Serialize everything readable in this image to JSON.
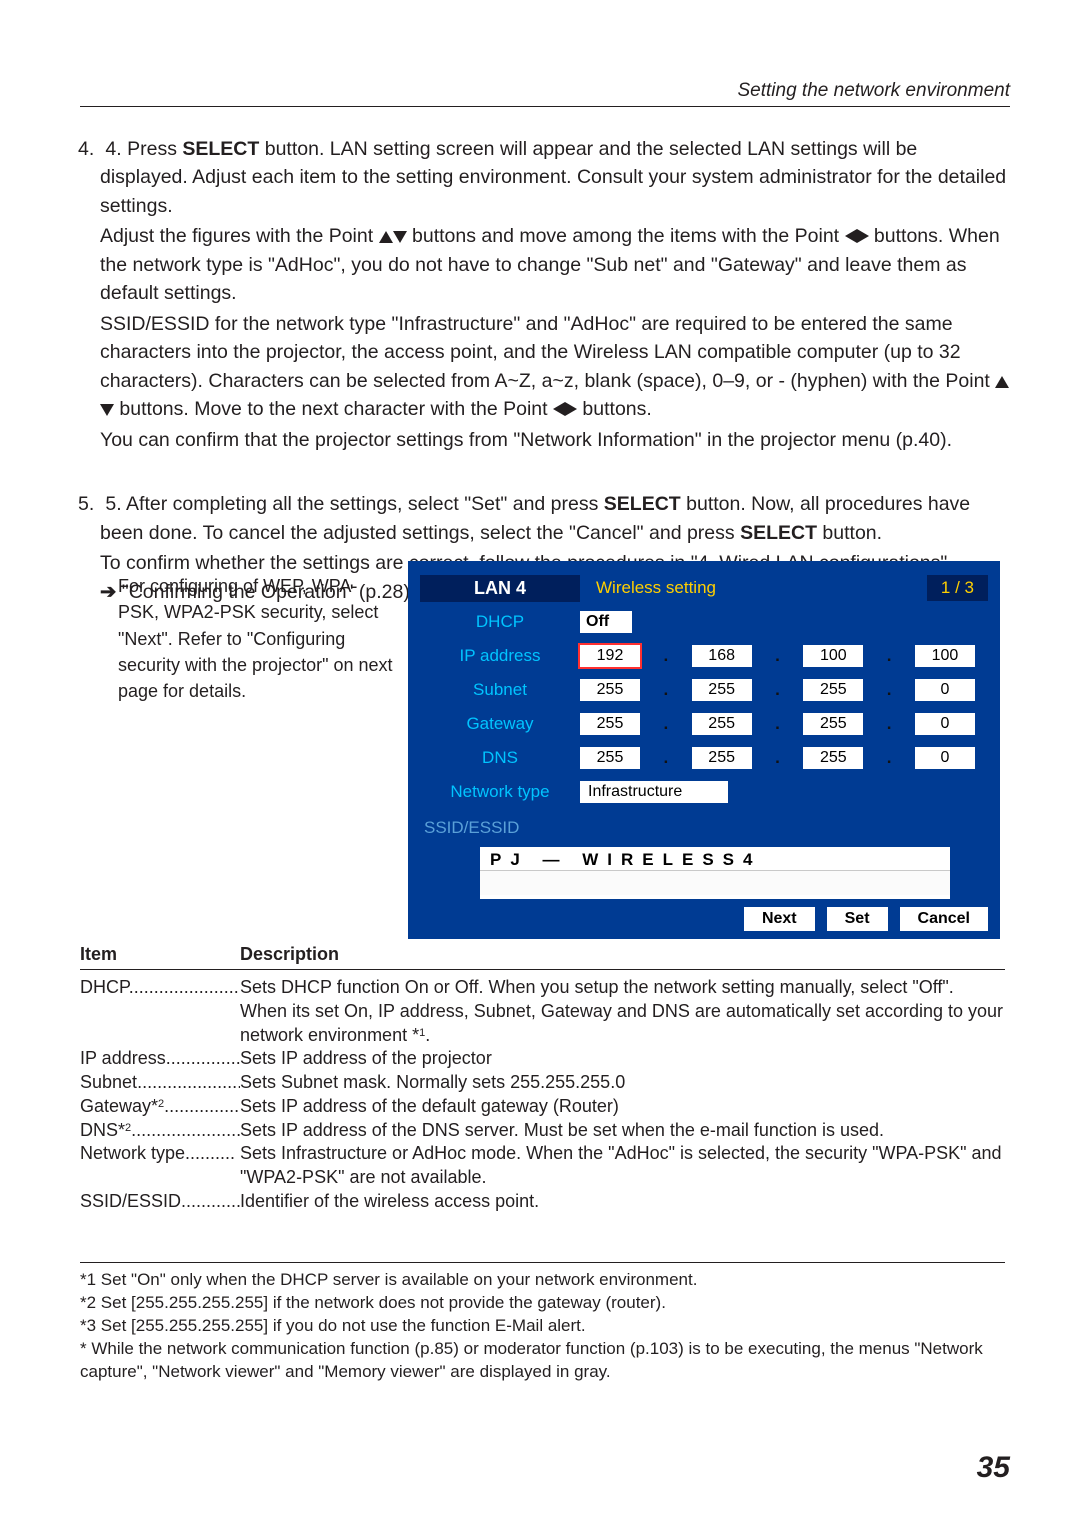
{
  "header": {
    "section_title": "Setting  the network environment"
  },
  "step4": {
    "line1_a": "4. Press ",
    "line1_b": "SELECT",
    "line1_c": " button. LAN setting screen will appear and the selected LAN settings will be displayed. Adjust each item to the setting environment. Consult your system administrator for the detailed settings.",
    "line2_a": "Adjust the figures with the Point ",
    "line2_b": " buttons and move among the items with the Point ",
    "line2_c": " buttons. When the network type is \"AdHoc\", you do not have to change \"Sub net\" and \"Gateway\" and leave them as default settings.",
    "line3": "SSID/ESSID for the network type \"Infrastructure\" and \"AdHoc\" are required to be entered the same characters into the projector, the access point, and the Wireless LAN compatible computer (up to 32 characters). Characters can be selected from A~Z, a~z, blank (space), 0–9, or - (hyphen) with the Point ",
    "line3_b": " buttons. Move to the next character with the Point ",
    "line3_c": " buttons.",
    "line4": "You can confirm that the projector settings from \"Network Information\" in the projector menu (p.40)."
  },
  "step5": {
    "line1_a": "5. After completing all the settings, select \"Set\" and press ",
    "line1_b": "SELECT",
    "line1_c": " button. Now, all procedures have been done. To cancel the adjusted settings, select the \"Cancel\" and press ",
    "line1_d": "SELECT",
    "line1_e": " button.",
    "line2": "To confirm whether the settings are correct, follow the procedures in \"4. Wired LAN configurations\" ",
    "line2_b": " \"Confirming the Operation\" (p.28)."
  },
  "sidenote": "For configuring of WEP, WPA-PSK, WPA2-PSK security, select \"Next\". Refer to  \"Configuring security with the projector\" on next page for details.",
  "panel": {
    "title": "LAN 4",
    "header": "Wireless setting",
    "page": "1 / 3",
    "labels": {
      "dhcp": "DHCP",
      "ip": "IP address",
      "subnet": "Subnet",
      "gateway": "Gateway",
      "dns": "DNS",
      "nettype": "Network type",
      "ssid": "SSID/ESSID"
    },
    "dhcp_value": "Off",
    "ip": [
      "192",
      "168",
      "100",
      "100"
    ],
    "subnet": [
      "255",
      "255",
      "255",
      "0"
    ],
    "gateway": [
      "255",
      "255",
      "255",
      "0"
    ],
    "dns": [
      "255",
      "255",
      "255",
      "0"
    ],
    "nettype_value": "Infrastructure",
    "ssid_value": "PJ — WIRELESS4",
    "btn_next": "Next",
    "btn_set": "Set",
    "btn_cancel": "Cancel"
  },
  "table": {
    "h_item": "Item",
    "h_desc": "Description",
    "rows": [
      {
        "item": "DHCP",
        "dots": "...........................",
        "desc": "Sets DHCP function On or Off. When you setup the network setting manually, select \"Off\". When its set On, IP address, Subnet, Gateway and DNS are automatically set according to your network environment *",
        "sup": "1",
        "desc_tail": "."
      },
      {
        "item": "IP address",
        "dots": ".................",
        "desc": "Sets IP address of the projector"
      },
      {
        "item": "Subnet",
        "dots": ".......................",
        "desc": "Sets Subnet mask. Normally sets 255.255.255.0"
      },
      {
        "item": "Gateway*",
        "sup_item": "2",
        "dots": "..................",
        "desc": "Sets IP address of the default gateway (Router)"
      },
      {
        "item": "DNS*",
        "sup_item": "2",
        "dots": "..........................",
        "desc": "Sets IP address of the DNS server. Must be set when the e-mail function is used."
      },
      {
        "item": "Network type",
        "dots": "..........",
        "desc": "Sets Infrastructure or AdHoc mode. When the \"AdHoc\" is selected, the security \"WPA-PSK\" and \"WPA2-PSK\" are not available."
      },
      {
        "item": "SSID/ESSID",
        "dots": "..................",
        "desc": "Identifier of the wireless access point."
      }
    ]
  },
  "footnotes": {
    "f1": "*1 Set \"On\" only when the DHCP server is available on your network environment.",
    "f2": "*2 Set [255.255.255.255] if the network does not provide the gateway (router).",
    "f3": "*3 Set [255.255.255.255] if you do not use the function E-Mail alert.",
    "f4": "* While the network communication function (p.85) or moderator function (p.103) is to be executing, the menus \"Network capture\", \"Network viewer\" and \"Memory viewer\" are displayed in gray."
  },
  "page_number": "35"
}
